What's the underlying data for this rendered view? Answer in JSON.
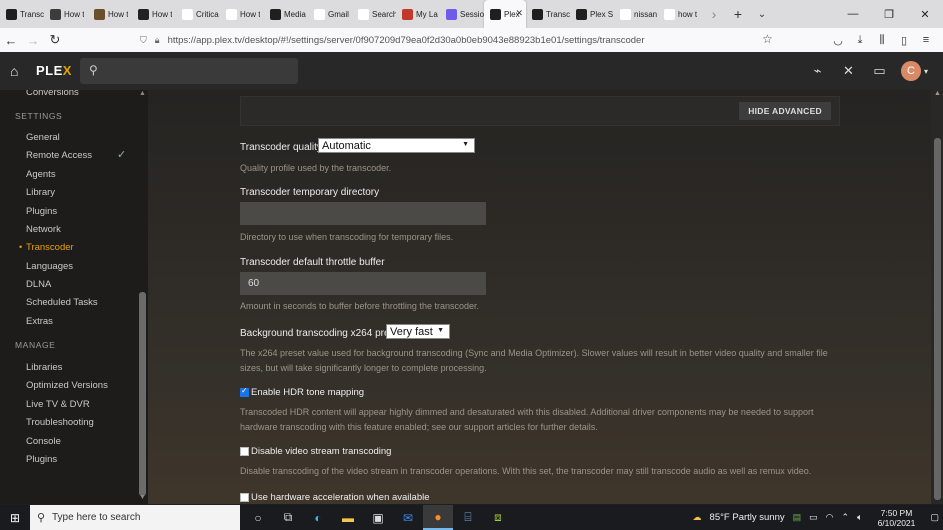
{
  "browser": {
    "tabs": [
      {
        "label": "Transc",
        "icon": "plex-icon",
        "color": "#1f1f1f"
      },
      {
        "label": "How t",
        "icon": "vm-icon",
        "color": "#3c3c3c"
      },
      {
        "label": "How t",
        "icon": "tool-icon",
        "color": "#6b4f2a"
      },
      {
        "label": "How t",
        "icon": "hex-icon",
        "color": "#222"
      },
      {
        "label": "Critica",
        "icon": "google-icon",
        "color": "#ffffff"
      },
      {
        "label": "How t",
        "icon": "ut-icon",
        "color": "#ffffff"
      },
      {
        "label": "Media",
        "icon": "plex-icon",
        "color": "#1f1f1f"
      },
      {
        "label": "Gmail",
        "icon": "gmail-icon",
        "color": "#ffffff"
      },
      {
        "label": "Search",
        "icon": "gmail-icon",
        "color": "#ffffff"
      },
      {
        "label": "My La",
        "icon": "abc-icon",
        "color": "#c0392b"
      },
      {
        "label": "Sessio",
        "icon": "session-icon",
        "color": "#6c5ce7"
      },
      {
        "label": "Plex",
        "icon": "plex-icon",
        "color": "#1f1f1f",
        "active": true
      },
      {
        "label": "Transc",
        "icon": "plex-icon",
        "color": "#1f1f1f"
      },
      {
        "label": "Plex S",
        "icon": "plex-icon",
        "color": "#1f1f1f"
      },
      {
        "label": "nissan",
        "icon": "google-icon",
        "color": "#ffffff"
      },
      {
        "label": "how t",
        "icon": "google-icon",
        "color": "#ffffff"
      }
    ],
    "url": "https://app.plex.tv/desktop/#!/settings/server/0f907209d79ea0f2d30a0b0eb9043e88923b1e01/settings/transcoder"
  },
  "plex": {
    "logo": "PLEX",
    "sidebar": {
      "top_item": "Conversions",
      "settings_heading": "SETTINGS",
      "settings_items": [
        "General",
        "Remote Access",
        "Agents",
        "Library",
        "Plugins",
        "Network",
        "Transcoder",
        "Languages",
        "DLNA",
        "Scheduled Tasks",
        "Extras"
      ],
      "active_item": "Transcoder",
      "manage_heading": "MANAGE",
      "manage_items": [
        "Libraries",
        "Optimized Versions",
        "Live TV & DVR",
        "Troubleshooting",
        "Console",
        "Plugins"
      ]
    },
    "main": {
      "hide_advanced": "HIDE ADVANCED",
      "quality_label": "Transcoder quality",
      "quality_value": "Automatic",
      "quality_help": "Quality profile used by the transcoder.",
      "tempdir_label": "Transcoder temporary directory",
      "tempdir_value": "",
      "tempdir_help": "Directory to use when transcoding for temporary files.",
      "throttle_label": "Transcoder default throttle buffer",
      "throttle_value": "60",
      "throttle_help": "Amount in seconds to buffer before throttling the transcoder.",
      "preset_label": "Background transcoding x264 preset",
      "preset_value": "Very fast",
      "preset_help": "The x264 preset value used for background transcoding (Sync and Media Optimizer). Slower values will result in better video quality and smaller file sizes, but will take significantly longer to complete processing.",
      "hdr_label": "Enable HDR tone mapping",
      "hdr_checked": true,
      "hdr_help": "Transcoded HDR content will appear highly dimmed and desaturated with this disabled. Additional driver components may be needed to support hardware transcoding with this feature enabled; see our support articles for further details.",
      "disable_video_label": "Disable video stream transcoding",
      "disable_video_checked": false,
      "disable_video_help": "Disable transcoding of the video stream in transcoder operations. With this set, the transcoder may still transcode audio as well as remux video.",
      "hw_accel_label": "Use hardware acceleration when available",
      "hw_accel_checked": false
    }
  },
  "taskbar": {
    "search_placeholder": "Type here to search",
    "weather": "85°F  Partly sunny",
    "time": "7:50 PM",
    "date": "6/10/2021"
  },
  "colors": {
    "accent": "#e5a00d",
    "check": "#7ec27e"
  }
}
